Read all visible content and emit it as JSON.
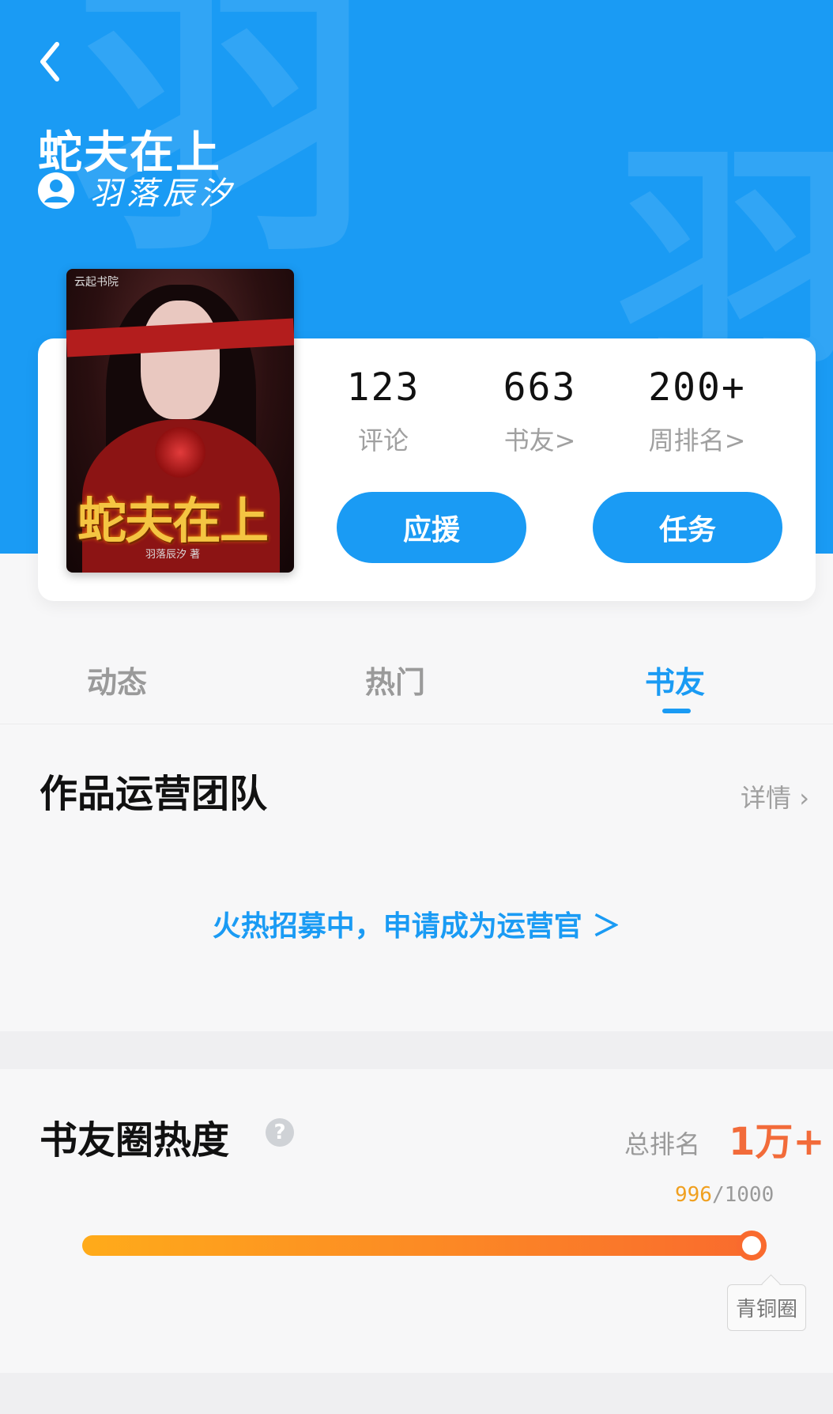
{
  "header": {
    "title": "蛇夫在上",
    "author": "羽落辰汐",
    "watermark": "羽"
  },
  "cover": {
    "publisher": "云起书院",
    "title": "蛇夫在上",
    "author": "羽落辰汐 著"
  },
  "stats": [
    {
      "value": "123",
      "label": "评论"
    },
    {
      "value": "663",
      "label": "书友>"
    },
    {
      "value": "200+",
      "label": "周排名>"
    }
  ],
  "actions": {
    "cheer_label": "应援",
    "task_label": "任务"
  },
  "tabs": [
    {
      "label": "动态",
      "active": false
    },
    {
      "label": "热门",
      "active": false
    },
    {
      "label": "书友",
      "active": true
    }
  ],
  "ops_team": {
    "title": "作品运营团队",
    "detail_label": "详情 ›",
    "recruit_text": "火热招募中，申请成为运营官 ＞"
  },
  "heat": {
    "title": "书友圈热度",
    "help_icon": "question-icon",
    "rank_label": "总排名",
    "rank_value": "1万+",
    "progress_current": "996",
    "progress_sep": "/",
    "progress_max": "1000",
    "progress_fraction": 0.996,
    "tier_label": "青铜圈"
  },
  "colors": {
    "primary": "#1a9bf4",
    "accent_orange": "#f96a2e",
    "progress_start": "#ffab1a"
  }
}
